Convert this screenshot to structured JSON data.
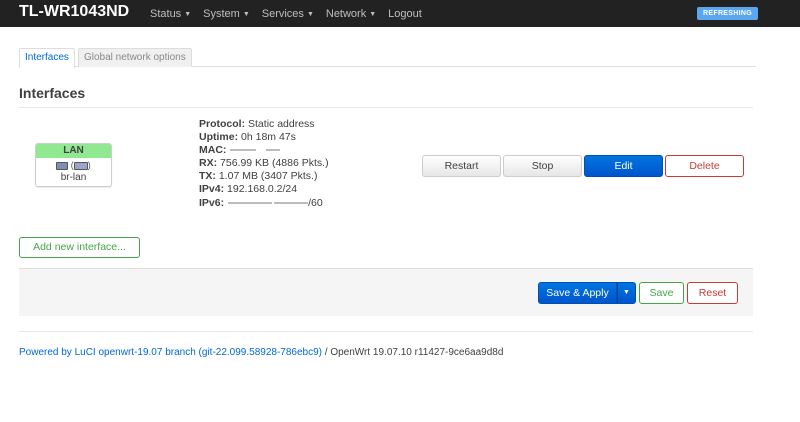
{
  "header": {
    "brand": "TL-WR1043ND",
    "nav": [
      {
        "label": "Status",
        "caret": "▼"
      },
      {
        "label": "System",
        "caret": "▼"
      },
      {
        "label": "Services",
        "caret": "▼"
      },
      {
        "label": "Network",
        "caret": "▼"
      },
      {
        "label": "Logout",
        "caret": ""
      }
    ],
    "refresh_badge": "REFRESHING",
    "refresh_color": "#5aa6f0"
  },
  "tabs": [
    {
      "label": "Interfaces",
      "active": true
    },
    {
      "label": "Global network options",
      "active": false
    }
  ],
  "section": {
    "title": "Interfaces"
  },
  "interface": {
    "name": "LAN",
    "device": "br-lan",
    "header_color": "#90e890",
    "icons": [
      "ethernet-port-icon",
      "bridge-icon"
    ],
    "status": {
      "protocol_label": "Protocol:",
      "protocol_value": "Static address",
      "uptime_label": "Uptime:",
      "uptime_value": "0h 18m 47s",
      "mac_label": "MAC:",
      "rx_label": "RX:",
      "rx_value": "756.99 KB (4886 Pkts.)",
      "tx_label": "TX:",
      "tx_value": "1.07 MB (3407 Pkts.)",
      "ipv4_label": "IPv4:",
      "ipv4_value": "192.168.0.2/24",
      "ipv6_label": "IPv6:",
      "ipv6_value": "/60"
    },
    "actions": {
      "restart": "Restart",
      "stop": "Stop",
      "edit": "Edit",
      "delete": "Delete"
    }
  },
  "add_interface_label": "Add new interface...",
  "actionbar": {
    "save_apply": "Save & Apply",
    "caret": "▼",
    "save": "Save",
    "reset": "Reset"
  },
  "footer": {
    "powered_by": "Powered by LuCI openwrt-19.07 branch (git-22.099.58928-786ebc9)",
    "version": " / OpenWrt 19.07.10 r11427-9ce6aa9d8d"
  },
  "colors": {
    "primary": "#0062d6",
    "danger": "#c43c35",
    "success": "#46a546",
    "topbar": "#222222"
  }
}
